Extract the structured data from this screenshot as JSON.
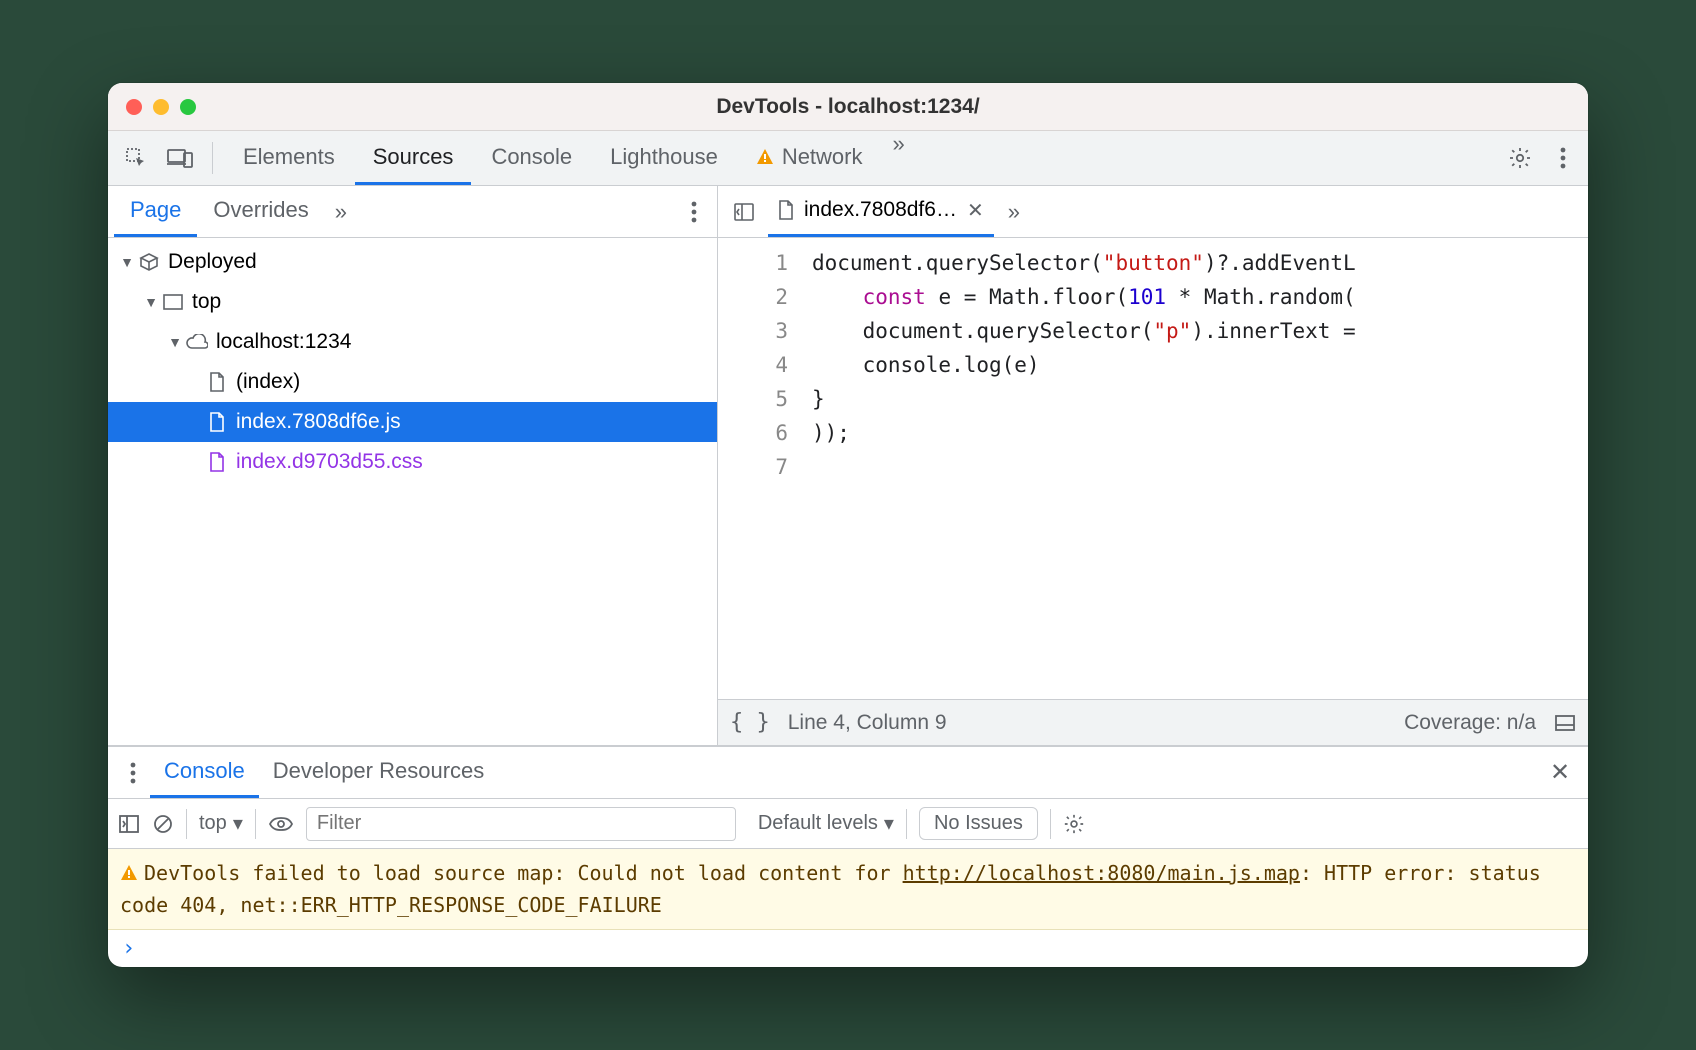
{
  "window": {
    "title": "DevTools - localhost:1234/"
  },
  "toolbar": {
    "tabs": [
      {
        "label": "Elements",
        "active": false
      },
      {
        "label": "Sources",
        "active": true
      },
      {
        "label": "Console",
        "active": false
      },
      {
        "label": "Lighthouse",
        "active": false
      },
      {
        "label": "Network",
        "active": false,
        "warning": true
      }
    ]
  },
  "sources": {
    "left_tabs": {
      "page": "Page",
      "overrides": "Overrides"
    },
    "tree": {
      "deployed": "Deployed",
      "top": "top",
      "host": "localhost:1234",
      "files": {
        "index": "(index)",
        "js": "index.7808df6e.js",
        "css": "index.d9703d55.css"
      }
    },
    "open_file": "index.7808df6…",
    "code": {
      "l1a": "document.querySelector(",
      "l1s": "\"button\"",
      "l1b": ")?.addEventL",
      "l2a": "    ",
      "l2kw": "const",
      "l2b": " e = Math.floor(",
      "l2n": "101",
      "l2c": " * Math.random(",
      "l3a": "    document.querySelector(",
      "l3s": "\"p\"",
      "l3b": ").innerText = ",
      "l4": "    console.log(e)",
      "l5": "}",
      "l6": "));",
      "l7": ""
    },
    "status": {
      "pos": "Line 4, Column 9",
      "coverage": "Coverage: n/a"
    }
  },
  "drawer": {
    "tabs": {
      "console": "Console",
      "devres": "Developer Resources"
    },
    "context": "top",
    "filter_placeholder": "Filter",
    "levels": "Default levels",
    "issues": "No Issues",
    "warning": {
      "pre": "DevTools failed to load source map: Could not load content for ",
      "link": "http://localhost:8080/main.js.map",
      "post": ": HTTP error: status code 404, net::ERR_HTTP_RESPONSE_CODE_FAILURE"
    }
  }
}
